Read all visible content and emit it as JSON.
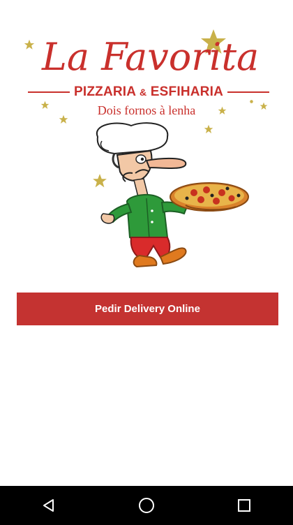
{
  "brand": {
    "name": "La Favorita",
    "subtitle_left": "PIZZARIA",
    "subtitle_amp": "&",
    "subtitle_right": "ESFIHARIA",
    "tagline": "Dois fornos à lenha"
  },
  "colors": {
    "brand_red": "#c9302c",
    "button_red": "#c43331",
    "star_gold": "#c9b14a",
    "navbar": "#000000"
  },
  "cta": {
    "label": "Pedir Delivery Online"
  },
  "navbar": {
    "back_icon": "back-triangle-icon",
    "home_icon": "home-circle-icon",
    "recents_icon": "recents-square-icon"
  }
}
